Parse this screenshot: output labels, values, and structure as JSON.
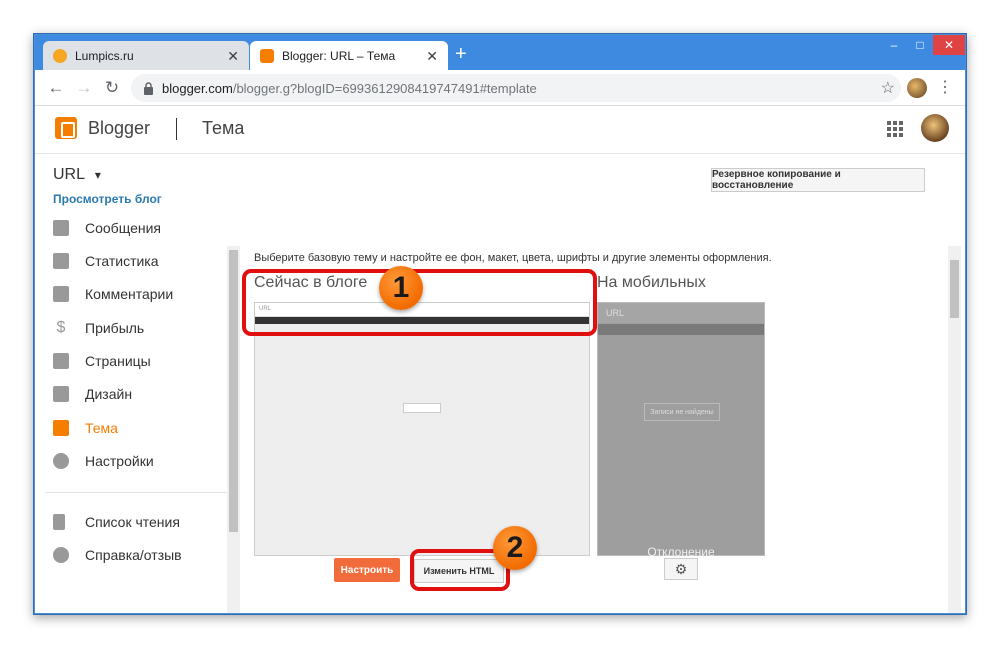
{
  "browser": {
    "tabs": [
      {
        "label": "Lumpics.ru",
        "favicon_color": "#f5a623"
      },
      {
        "label": "Blogger: URL – Тема",
        "favicon_color": "#f57d00"
      }
    ],
    "close_glyph": "✕",
    "new_tab_glyph": "+",
    "window_controls": {
      "minimize": "–",
      "maximize": "□",
      "close": "✕"
    },
    "nav": {
      "back": "←",
      "forward": "→",
      "reload": "↻"
    },
    "url": {
      "host": "blogger.com",
      "path": "/blogger.g?blogID=6993612908419747491#template"
    },
    "star_glyph": "☆",
    "menu_glyph": "⋮"
  },
  "header": {
    "brand": "Blogger",
    "section": "Тема"
  },
  "blog": {
    "name": "URL",
    "dropdown_glyph": "▾",
    "view_link": "Просмотреть блог"
  },
  "backup_button": "Резервное копирование и восстановление",
  "sidebar": {
    "items": [
      {
        "label": "Сообщения",
        "icon": "posts-icon",
        "active": false
      },
      {
        "label": "Статистика",
        "icon": "stats-icon",
        "active": false
      },
      {
        "label": "Комментарии",
        "icon": "comments-icon",
        "active": false
      },
      {
        "label": "Прибыль",
        "icon": "dollar-icon",
        "active": false
      },
      {
        "label": "Страницы",
        "icon": "pages-icon",
        "active": false
      },
      {
        "label": "Дизайн",
        "icon": "layout-icon",
        "active": false
      },
      {
        "label": "Тема",
        "icon": "theme-icon",
        "active": true
      },
      {
        "label": "Настройки",
        "icon": "settings-icon",
        "active": false
      }
    ],
    "secondary": [
      {
        "label": "Список чтения",
        "icon": "bookmark-icon"
      },
      {
        "label": "Справка/отзыв",
        "icon": "help-icon"
      }
    ]
  },
  "main": {
    "intro": "Выберите базовую тему и настройте ее фон, макет, цвета, шрифты и другие элементы оформления.",
    "desktop_title": "Сейчас в блоге",
    "mobile_title": "На мобильных",
    "desktop_preview": {
      "blog_title": "URL"
    },
    "mobile_preview": {
      "blog_title": "URL",
      "empty_message": "Записи не найдены",
      "footer": "Отклонение"
    },
    "configure_button": "Настроить",
    "edit_html_button": "Изменить HTML",
    "mobile_settings_glyph": "⚙"
  },
  "annotations": [
    {
      "number": "1",
      "color": "#e01010"
    },
    {
      "number": "2",
      "color": "#e01010"
    }
  ]
}
